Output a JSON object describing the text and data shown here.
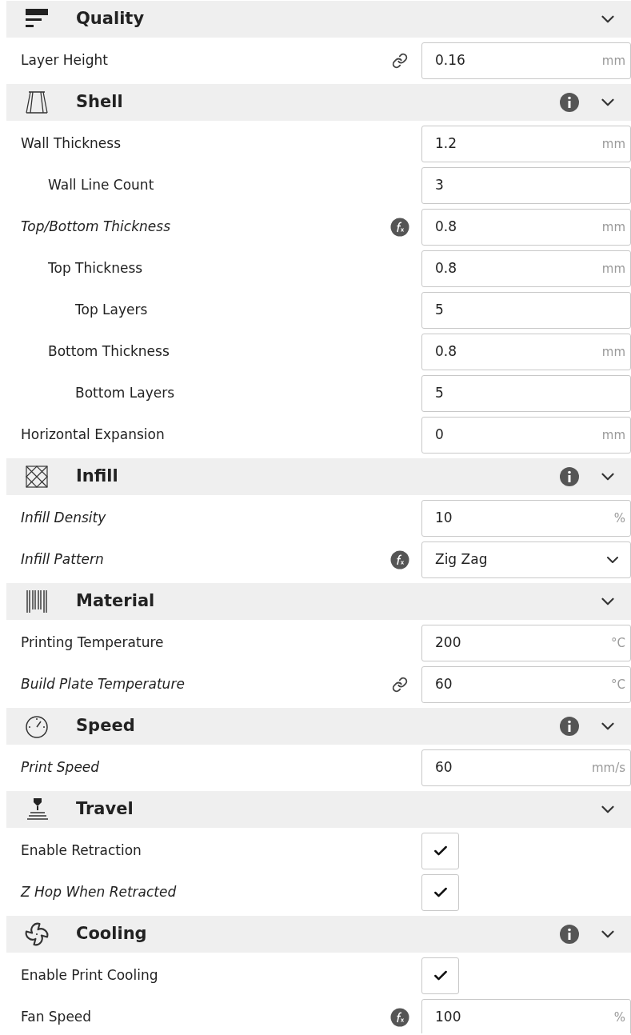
{
  "sections": [
    {
      "title": "Quality",
      "kind": "quality",
      "info": false,
      "settings": [
        {
          "label": "Layer Height",
          "italic": false,
          "linked": true,
          "formula": false,
          "kind": "number",
          "value": "0.16",
          "unit": "mm"
        }
      ]
    },
    {
      "title": "Shell",
      "kind": "shell",
      "info": true,
      "settings": [
        {
          "label": "Wall Thickness",
          "italic": false,
          "linked": false,
          "formula": false,
          "kind": "number",
          "value": "1.2",
          "unit": "mm",
          "children": [
            {
              "label": "Wall Line Count",
              "italic": false,
              "linked": false,
              "formula": false,
              "kind": "number",
              "value": "3"
            }
          ]
        },
        {
          "label": "Top/Bottom Thickness",
          "italic": true,
          "linked": false,
          "formula": true,
          "kind": "number",
          "value": "0.8",
          "unit": "mm",
          "children": [
            {
              "label": "Top Thickness",
              "italic": false,
              "linked": false,
              "formula": false,
              "kind": "number",
              "value": "0.8",
              "unit": "mm",
              "children": [
                {
                  "label": "Top Layers",
                  "italic": false,
                  "linked": false,
                  "formula": false,
                  "kind": "number",
                  "value": "5"
                }
              ]
            },
            {
              "label": "Bottom Thickness",
              "italic": false,
              "linked": false,
              "formula": false,
              "kind": "number",
              "value": "0.8",
              "unit": "mm",
              "children": [
                {
                  "label": "Bottom Layers",
                  "italic": false,
                  "linked": false,
                  "formula": false,
                  "kind": "number",
                  "value": "5"
                }
              ]
            }
          ]
        },
        {
          "label": "Horizontal Expansion",
          "italic": false,
          "linked": false,
          "formula": false,
          "kind": "number",
          "value": "0",
          "unit": "mm"
        }
      ]
    },
    {
      "title": "Infill",
      "kind": "infill",
      "info": true,
      "settings": [
        {
          "label": "Infill Density",
          "italic": true,
          "linked": false,
          "formula": false,
          "kind": "number",
          "value": "10",
          "unit": "%"
        },
        {
          "label": "Infill Pattern",
          "italic": true,
          "linked": false,
          "formula": true,
          "kind": "dropdown",
          "value": "Zig Zag"
        }
      ]
    },
    {
      "title": "Material",
      "kind": "material",
      "info": false,
      "settings": [
        {
          "label": "Printing Temperature",
          "italic": false,
          "linked": false,
          "formula": false,
          "kind": "number",
          "value": "200",
          "unit": "°C"
        },
        {
          "label": "Build Plate Temperature",
          "italic": true,
          "linked": true,
          "formula": false,
          "kind": "number",
          "value": "60",
          "unit": "°C"
        }
      ]
    },
    {
      "title": "Speed",
      "kind": "speed",
      "info": true,
      "settings": [
        {
          "label": "Print Speed",
          "italic": true,
          "linked": false,
          "formula": false,
          "kind": "number",
          "value": "60",
          "unit": "mm/s"
        }
      ]
    },
    {
      "title": "Travel",
      "kind": "travel",
      "info": false,
      "settings": [
        {
          "label": "Enable Retraction",
          "italic": false,
          "linked": false,
          "formula": false,
          "kind": "checkbox",
          "checked": true
        },
        {
          "label": "Z Hop When Retracted",
          "italic": true,
          "linked": false,
          "formula": false,
          "kind": "checkbox",
          "checked": true
        }
      ]
    },
    {
      "title": "Cooling",
      "kind": "cooling",
      "info": true,
      "settings": [
        {
          "label": "Enable Print Cooling",
          "italic": false,
          "linked": false,
          "formula": false,
          "kind": "checkbox",
          "checked": true
        },
        {
          "label": "Fan Speed",
          "italic": false,
          "linked": false,
          "formula": true,
          "kind": "number",
          "value": "100",
          "unit": "%"
        }
      ]
    }
  ]
}
